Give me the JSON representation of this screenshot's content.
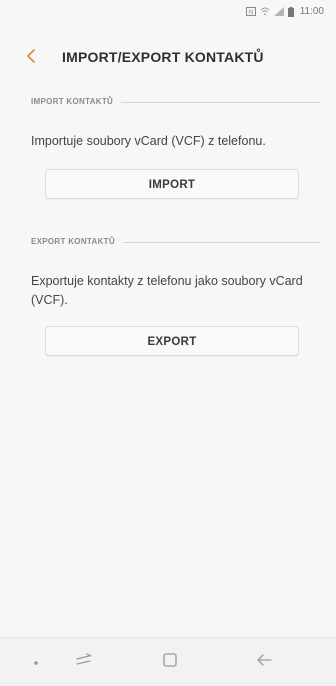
{
  "status_bar": {
    "time": "11:00"
  },
  "header": {
    "title": "IMPORT/EXPORT KONTAKTŮ",
    "back_icon": "chevron-left-icon",
    "accent_color": "#d98b2b"
  },
  "import_section": {
    "heading": "IMPORT KONTAKTŮ",
    "description": "Importuje soubory vCard (VCF) z telefonu.",
    "button_label": "IMPORT"
  },
  "export_section": {
    "heading": "EXPORT KONTAKTŮ",
    "description": "Exportuje kontakty z telefonu jako soubory vCard (VCF).",
    "button_label": "EXPORT"
  },
  "nav_bar": {
    "items": [
      "dot-icon",
      "recent-apps-icon",
      "home-icon",
      "back-arrow-icon"
    ]
  }
}
